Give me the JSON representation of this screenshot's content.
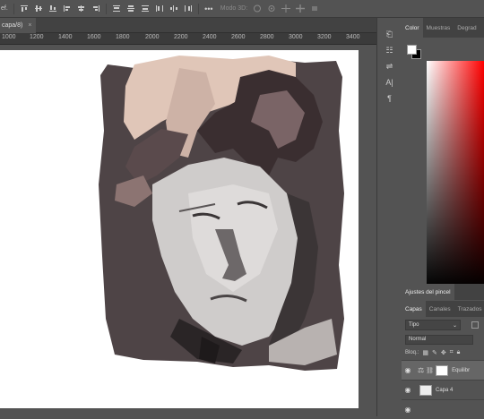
{
  "options_bar": {
    "left_fragment": "ef.",
    "mode_3d_label": "Modo 3D:"
  },
  "document": {
    "tab_title": "capa/8)",
    "tab_close": "×"
  },
  "ruler": {
    "ticks": [
      "1000",
      "1200",
      "1400",
      "1600",
      "1800",
      "2000",
      "2200",
      "2400",
      "2600",
      "2800",
      "3000",
      "3200",
      "3400"
    ]
  },
  "color_panel": {
    "tabs": [
      "Color",
      "Muestras",
      "Degrad"
    ]
  },
  "brush_panel": {
    "title": "Ajustes del pincel"
  },
  "layers_panel": {
    "tabs": [
      "Capas",
      "Canales",
      "Trazados"
    ],
    "filter_kind": "Tipo",
    "blend_mode": "Normal",
    "lock_label": "Bloq.:",
    "layers": [
      {
        "name": "Equilibr"
      },
      {
        "name": "Capa 4"
      }
    ]
  },
  "icons": {
    "align_left": "align-left-icon",
    "visible": "eye-icon"
  }
}
